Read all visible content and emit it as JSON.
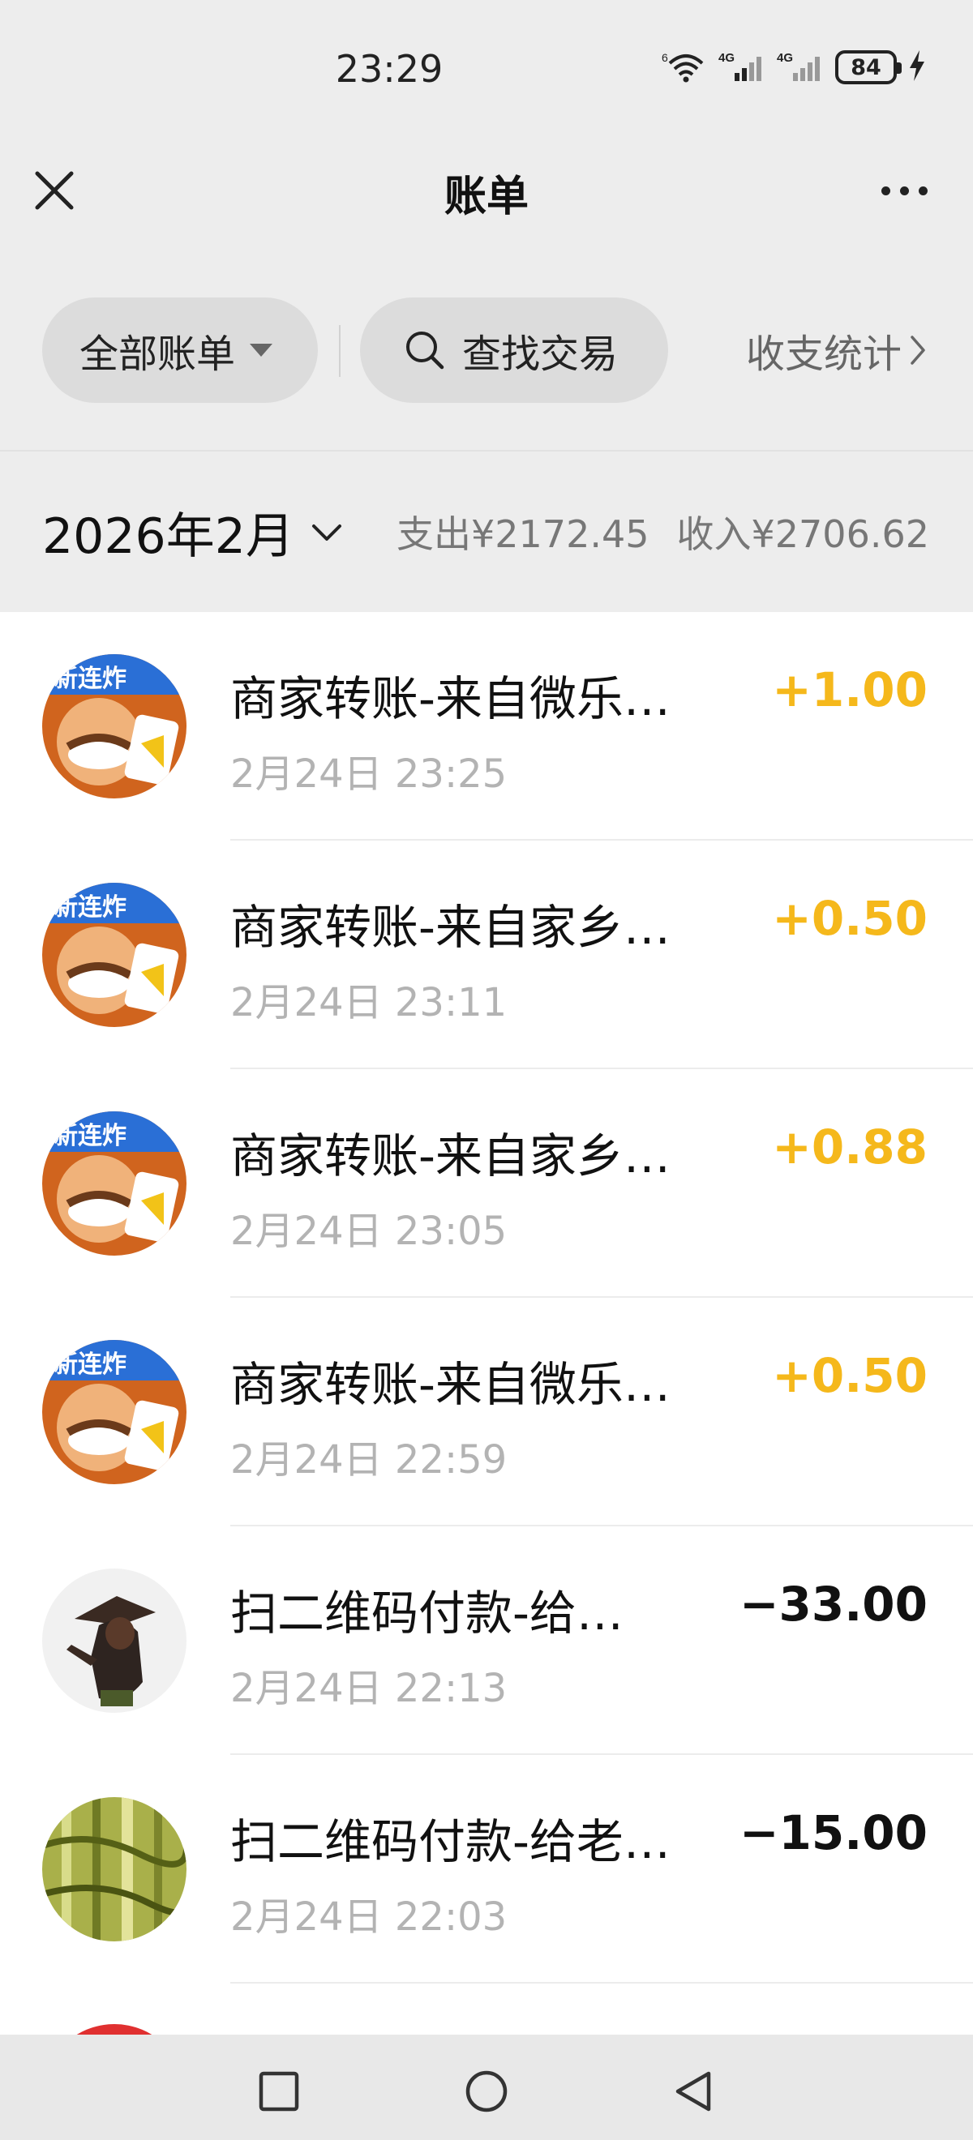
{
  "status_bar": {
    "time": "23:29",
    "network1": "4G",
    "network2": "4G",
    "battery": "84",
    "wifi_badge": "6"
  },
  "header": {
    "title": "账单",
    "close_icon": "close-icon",
    "more_icon": "more-icon"
  },
  "filters": {
    "all_bills": "全部账单",
    "search": "查找交易",
    "stats": "收支统计"
  },
  "month": {
    "label": "2026年2月",
    "expense": "支出¥2172.45",
    "income": "收入¥2706.62"
  },
  "transactions": [
    {
      "title": "商家转账-来自微乐…",
      "time": "2月24日 23:25",
      "amount": "+1.00",
      "kind": "income",
      "avatar": "game-avatar"
    },
    {
      "title": "商家转账-来自家乡…",
      "time": "2月24日 23:11",
      "amount": "+0.50",
      "kind": "income",
      "avatar": "game-avatar"
    },
    {
      "title": "商家转账-来自家乡…",
      "time": "2月24日 23:05",
      "amount": "+0.88",
      "kind": "income",
      "avatar": "game-avatar"
    },
    {
      "title": "商家转账-来自微乐…",
      "time": "2月24日 22:59",
      "amount": "+0.50",
      "kind": "income",
      "avatar": "game-avatar"
    },
    {
      "title": "扫二维码付款-给…",
      "time": "2月24日 22:13",
      "amount": "−33.00",
      "kind": "expense",
      "avatar": "warrior-avatar"
    },
    {
      "title": "扫二维码付款-给老…",
      "time": "2月24日 22:03",
      "amount": "−15.00",
      "kind": "expense",
      "avatar": "bamboo-avatar"
    }
  ],
  "colors": {
    "income": "#f5b81b",
    "expense": "#111111",
    "background": "#ededed"
  },
  "nav": {
    "recent_icon": "square-icon",
    "home_icon": "circle-icon",
    "back_icon": "triangle-back-icon"
  }
}
